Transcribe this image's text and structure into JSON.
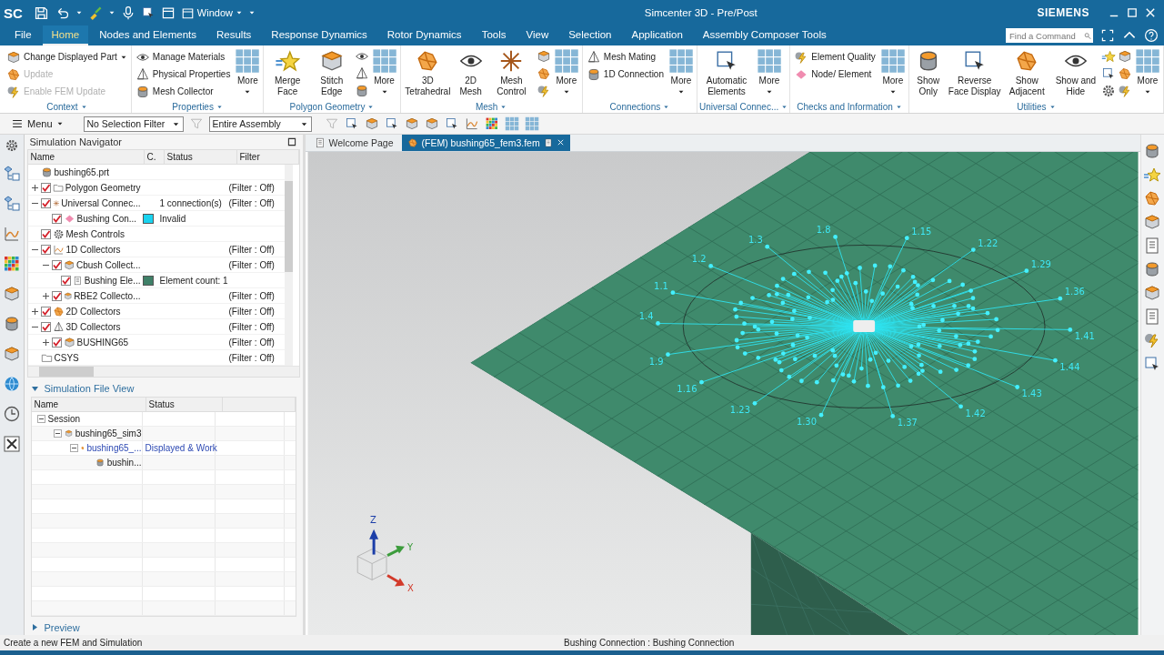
{
  "app_logo": "SC",
  "quick_access": {
    "window_menu": "Window"
  },
  "window": {
    "title": "Simcenter 3D - Pre/Post",
    "brand": "SIEMENS"
  },
  "menu_tabs": [
    {
      "label": "File",
      "selected": false
    },
    {
      "label": "Home",
      "selected": true
    },
    {
      "label": "Nodes and Elements",
      "selected": false
    },
    {
      "label": "Results",
      "selected": false
    },
    {
      "label": "Response Dynamics",
      "selected": false
    },
    {
      "label": "Rotor Dynamics",
      "selected": false
    },
    {
      "label": "Tools",
      "selected": false
    },
    {
      "label": "View",
      "selected": false
    },
    {
      "label": "Selection",
      "selected": false
    },
    {
      "label": "Application",
      "selected": false
    },
    {
      "label": "Assembly Composer Tools",
      "selected": false
    }
  ],
  "search": {
    "placeholder": "Find a Command"
  },
  "ribbon_groups": [
    {
      "label": "Context",
      "items": [
        {
          "kind": "column",
          "entries": [
            {
              "label": "Change Displayed Part",
              "disabled": false,
              "dropdown": true
            },
            {
              "label": "Update",
              "disabled": true
            },
            {
              "label": "Enable FEM Update",
              "disabled": true
            }
          ]
        }
      ]
    },
    {
      "label": "Properties",
      "items": [
        {
          "kind": "column",
          "entries": [
            {
              "label": "Manage Materials",
              "disabled": false
            },
            {
              "label": "Physical Properties",
              "disabled": false
            },
            {
              "label": "Mesh Collector",
              "disabled": false
            }
          ]
        },
        {
          "kind": "more",
          "label": "More"
        }
      ]
    },
    {
      "label": "Polygon Geometry",
      "items": [
        {
          "kind": "large",
          "label": "Merge Face"
        },
        {
          "kind": "large",
          "label": "Stitch Edge"
        },
        {
          "kind": "icons"
        },
        {
          "kind": "more",
          "label": "More"
        }
      ]
    },
    {
      "label": "Mesh",
      "items": [
        {
          "kind": "large",
          "label": "3D Tetrahedral"
        },
        {
          "kind": "large",
          "label": "2D Mesh"
        },
        {
          "kind": "large",
          "label": "Mesh Control"
        },
        {
          "kind": "icons"
        },
        {
          "kind": "more",
          "label": "More"
        }
      ]
    },
    {
      "label": "Connections",
      "items": [
        {
          "kind": "column",
          "entries": [
            {
              "label": "Mesh Mating",
              "disabled": false
            },
            {
              "label": "1D Connection",
              "disabled": false
            }
          ]
        },
        {
          "kind": "more",
          "label": "More"
        }
      ]
    },
    {
      "label": "Universal Connec...",
      "items": [
        {
          "kind": "large",
          "label": "Automatic Elements"
        },
        {
          "kind": "more",
          "label": "More"
        }
      ]
    },
    {
      "label": "Checks and Information",
      "items": [
        {
          "kind": "column",
          "entries": [
            {
              "label": "Element Quality",
              "disabled": false
            },
            {
              "label": "Node/ Element",
              "disabled": false
            }
          ]
        },
        {
          "kind": "more",
          "label": "More"
        }
      ]
    },
    {
      "label": "Utilities",
      "items": [
        {
          "kind": "large",
          "label": "Show Only"
        },
        {
          "kind": "large",
          "label": "Reverse Face Display"
        },
        {
          "kind": "large",
          "label": "Show Adjacent"
        },
        {
          "kind": "large",
          "label": "Show and Hide"
        },
        {
          "kind": "icons"
        },
        {
          "kind": "icons"
        },
        {
          "kind": "more",
          "label": "More"
        }
      ]
    }
  ],
  "toolbar": {
    "menu": "Menu",
    "selection_filter": "No Selection Filter",
    "scope": "Entire Assembly"
  },
  "navigator": {
    "title": "Simulation Navigator",
    "columns": [
      "Name",
      "C.",
      "Status",
      "Filter"
    ],
    "tree": [
      {
        "name": "bushing65.prt"
      },
      {
        "name": "Polygon Geometry",
        "checked": true,
        "expanded": false,
        "filter": "(Filter : Off)"
      },
      {
        "name": "Universal Connec...",
        "checked": true,
        "expanded": true,
        "status": "1 connection(s)",
        "filter": "(Filter : Off)",
        "children": [
          {
            "name": "Bushing Con...",
            "checked": true,
            "color": "#19d3ef",
            "status": "Invalid"
          }
        ]
      },
      {
        "name": "Mesh Controls",
        "checked": true
      },
      {
        "name": "1D Collectors",
        "checked": true,
        "expanded": true,
        "filter": "(Filter : Off)",
        "children": [
          {
            "name": "Cbush Collect...",
            "checked": true,
            "expanded": true,
            "filter": "(Filter : Off)",
            "children": [
              {
                "name": "Bushing Ele...",
                "checked": true,
                "color": "#3f8068",
                "status": "Element count: 1"
              }
            ]
          },
          {
            "name": "RBE2 Collecto...",
            "checked": true,
            "expanded": false,
            "filter": "(Filter : Off)"
          }
        ]
      },
      {
        "name": "2D Collectors",
        "checked": true,
        "expanded": false,
        "filter": "(Filter : Off)"
      },
      {
        "name": "3D Collectors",
        "checked": true,
        "expanded": true,
        "filter": "(Filter : Off)",
        "children": [
          {
            "name": "BUSHING65",
            "checked": true,
            "expanded": false,
            "filter": "(Filter : Off)"
          }
        ]
      },
      {
        "name": "CSYS",
        "filter": "(Filter : Off)"
      }
    ]
  },
  "file_view": {
    "title": "Simulation File View",
    "expanded": true,
    "columns": [
      "Name",
      "Status"
    ],
    "tree": [
      {
        "name": "Session",
        "expanded": true,
        "active": false,
        "children": [
          {
            "name": "bushing65_sim3",
            "expanded": true,
            "active": false,
            "children": [
              {
                "name": "bushing65_...",
                "expanded": true,
                "active": true,
                "status": "Displayed & Work",
                "children": [
                  {
                    "name": "bushin...",
                    "active": false
                  }
                ]
              }
            ]
          }
        ]
      }
    ]
  },
  "preview": {
    "title": "Preview",
    "expanded": false
  },
  "viewport_tabs": [
    {
      "label": "Welcome Page",
      "selected": false
    },
    {
      "label": "(FEM) bushing65_fem3.fem",
      "selected": true
    }
  ],
  "node_labels": [
    "1.3",
    "1.8",
    "1.15",
    "1.22",
    "1.29",
    "1.36",
    "1.41",
    "1.44",
    "1.43",
    "1.42",
    "1.37",
    "1.30",
    "1.23",
    "1.16",
    "1.9",
    "1.4",
    "1.1",
    "1.2"
  ],
  "triad": {
    "z": "Z",
    "y": "Y",
    "x": "X"
  },
  "status_bar": {
    "message": "Create a new FEM and Simulation",
    "selection": "Bushing Connection : Bushing Connection"
  }
}
